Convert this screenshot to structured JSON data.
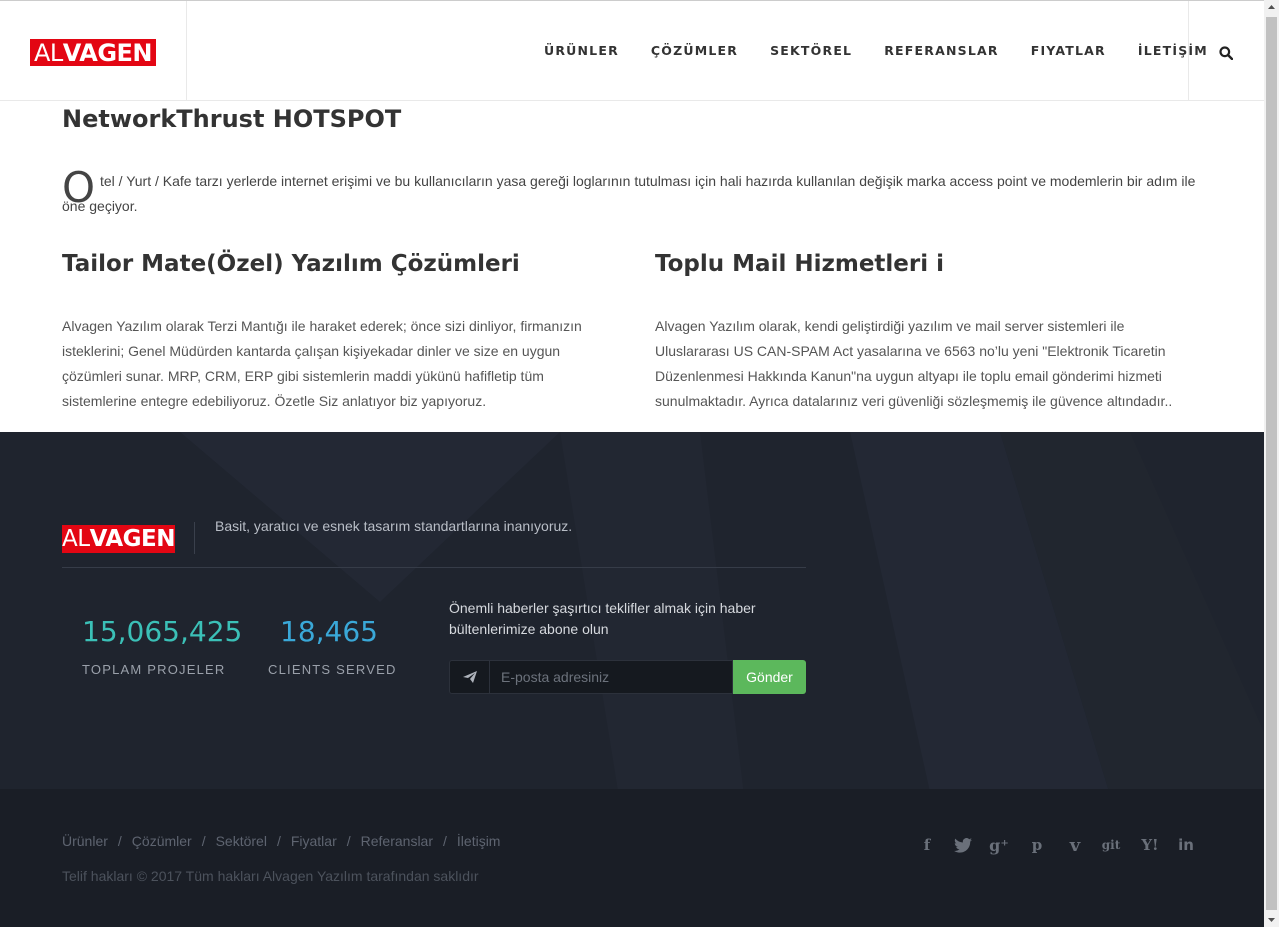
{
  "brand": {
    "logo_prefix": "AL",
    "logo_rest": "VAGEN",
    "color": "#e30613"
  },
  "nav": [
    "ÜRÜNLER",
    "ÇÖZÜMLER",
    "SEKTÖREL",
    "REFERANSLAR",
    "FIYATLAR",
    "İLETİŞİM"
  ],
  "header": {
    "search_icon": "search-icon"
  },
  "main": {
    "title": "NetworkThrust HOTSPOT",
    "dropcap": "O",
    "intro": "tel / Yurt / Kafe tarzı yerlerde internet erişimi ve bu kullanıcıların yasa gereği loglarının tutulması için hali hazırda kullanılan değişik marka access point ve modemlerin bir adım ile",
    "intro_cont": "öne geçiyor.",
    "col1": {
      "title": "Tailor Mate(Özel) Yazılım Çözümleri",
      "lines": [
        "Alvagen Yazılım olarak Terzi Mantığı ile haraket ederek; önce sizi dinliyor, firmanızın",
        "isteklerini; Genel Müdürden kantarda çalışan kişiyekadar dinler ve size en uygun",
        "çözümleri sunar. MRP, CRM, ERP gibi sistemlerin maddi yükünü hafifletip tüm",
        "sistemlerine entegre edebiliyoruz. Özetle Siz anlatıyor biz yapıyoruz."
      ]
    },
    "col2": {
      "title": "Toplu Mail Hizmetleri i",
      "lines": [
        "Alvagen Yazılım olarak, kendi geliştirdiği yazılım ve mail server sistemleri ile",
        "Uluslararası US CAN-SPAM Act yasalarına ve 6563 no’lu yeni \"Elektronik Ticaretin",
        "Düzenlenmesi Hakkında Kanun\"na uygun altyapı ile toplu email gönderimi hizmeti",
        "sunulmaktadır. Ayrıca datalarınız veri güvenliği sözleşmemiş ile güvence altındadır.."
      ]
    }
  },
  "footer": {
    "tagline": "Basit, yaratıcı ve esnek tasarım standartlarına inanıyoruz.",
    "stats": [
      {
        "value": "15,065,425",
        "label": "TOPLAM PROJELER"
      },
      {
        "value": "18,465",
        "label": "CLIENTS SERVED"
      }
    ],
    "newsletter": {
      "text": "Önemli haberler şaşırtıcı teklifler almak için haber bültenlerimize abone olun",
      "placeholder": "E-posta adresiniz",
      "button": "Gönder",
      "icon": "paper-plane-icon"
    },
    "links": [
      "Ürünler",
      "Çözümler",
      "Sektörel",
      "Fiyatlar",
      "Referanslar",
      "İletişim"
    ],
    "separator": "/",
    "copyright": "Telif hakları © 2017 Tüm hakları Alvagen Yazılım tarafından saklıdır",
    "social": [
      {
        "name": "facebook-icon",
        "glyph": "f"
      },
      {
        "name": "twitter-icon",
        "glyph": ""
      },
      {
        "name": "google-plus-icon",
        "glyph": "g⁺"
      },
      {
        "name": "pinterest-icon",
        "glyph": "p"
      },
      {
        "name": "vimeo-icon",
        "glyph": "v"
      },
      {
        "name": "git-icon",
        "glyph": "git"
      },
      {
        "name": "yahoo-icon",
        "glyph": "Y!"
      },
      {
        "name": "linkedin-icon",
        "glyph": "in"
      }
    ],
    "accent": "#3bc0b7",
    "button_color": "#5cb85c"
  }
}
